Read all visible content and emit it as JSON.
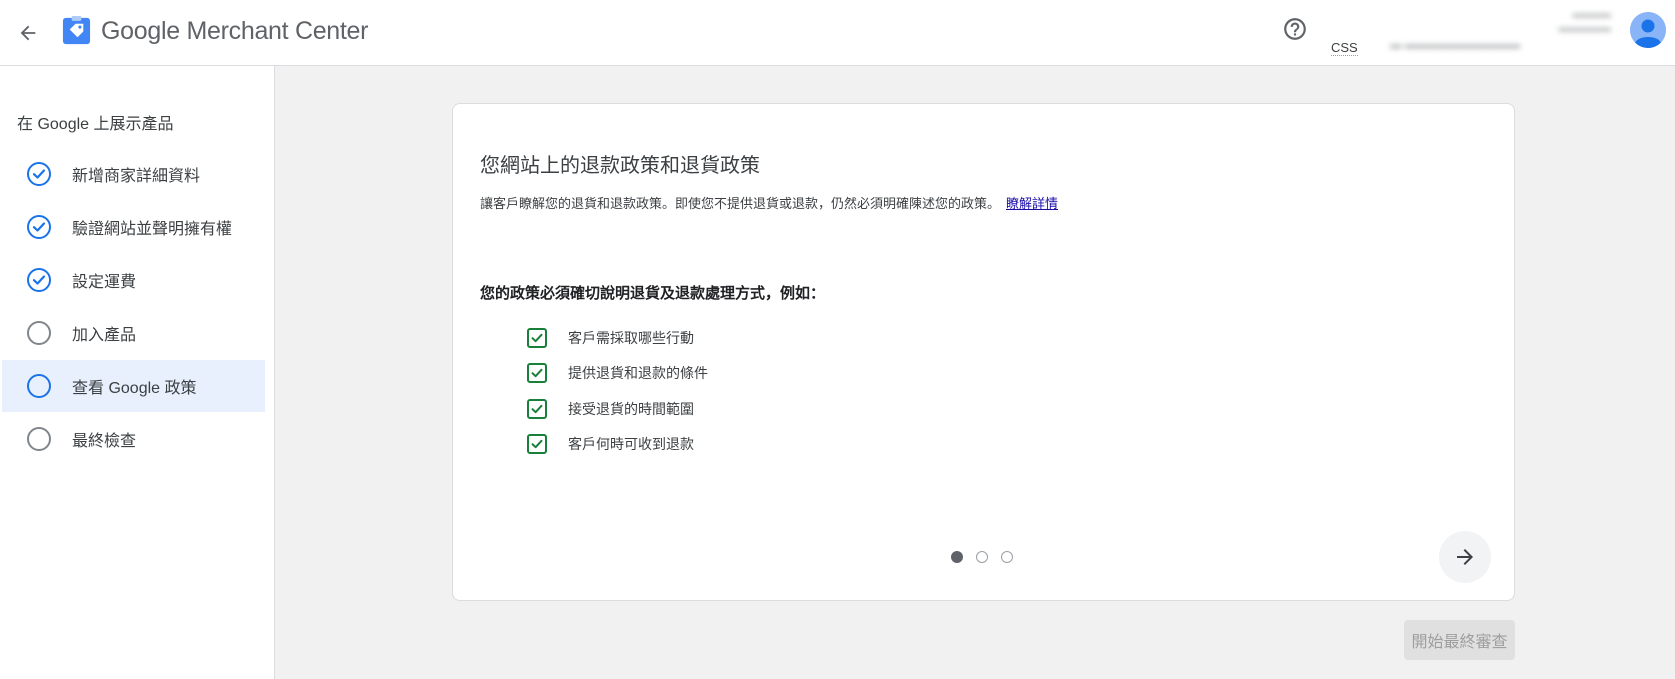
{
  "header": {
    "brand_google": "Google",
    "brand_product": "Merchant Center",
    "css_label": "CSS",
    "account_line1": "•••••••••••",
    "account_line2": "•••••••••••••••",
    "account_detail": "••• ••••••••••••••••••••••••••••••"
  },
  "sidebar": {
    "heading": "在 Google 上展示產品",
    "steps": [
      {
        "label": "新增商家詳細資料",
        "state": "done"
      },
      {
        "label": "驗證網站並聲明擁有權",
        "state": "done"
      },
      {
        "label": "設定運費",
        "state": "done"
      },
      {
        "label": "加入產品",
        "state": "todo"
      },
      {
        "label": "查看 Google 政策",
        "state": "active"
      },
      {
        "label": "最終檢查",
        "state": "todo"
      }
    ]
  },
  "card": {
    "title": "您網站上的退款政策和退貨政策",
    "description": "讓客戶瞭解您的退貨和退款政策。即使您不提供退貨或退款，仍然必須明確陳述您的政策。",
    "learn_more": "瞭解詳情",
    "subheading": "您的政策必須確切說明退貨及退款處理方式，例如：",
    "checklist": [
      "客戶需採取哪些行動",
      "提供退貨和退款的條件",
      "接受退貨的時間範圍",
      "客戶何時可收到退款"
    ],
    "pagination_current": 1,
    "pagination_total": 3
  },
  "footer": {
    "final_review_label": "開始最終審查"
  },
  "colors": {
    "accent": "#1a73e8",
    "check_green": "#188038",
    "link": "#1a0dab"
  }
}
